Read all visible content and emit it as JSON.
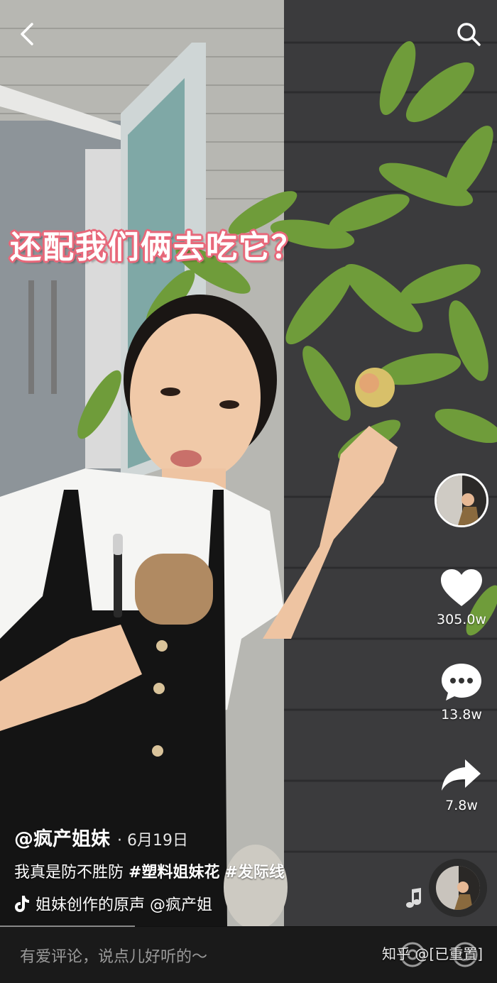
{
  "caption": "还配我们俩去吃它？",
  "stats": {
    "likes": "305.0w",
    "comments": "13.8w",
    "shares": "7.8w"
  },
  "post": {
    "author": "@疯产姐妹",
    "date": "· 6月19日",
    "desc_text": "我真是防不胜防",
    "tags": [
      "#塑料姐妹花",
      "#发际线"
    ],
    "music": "姐妹创作的原声 @疯产姐"
  },
  "comment_placeholder": "有爱评论，说点儿好听的～",
  "watermark": "知乎 @[已重置]",
  "colors": {
    "caption_outline": "#e8687a",
    "bottom_bar": "#1a1a1a"
  },
  "icons": [
    "back-icon",
    "search-icon",
    "heart-icon",
    "comment-icon",
    "share-icon",
    "music-note-icon",
    "tiktok-logo-icon",
    "at-icon",
    "emoji-icon"
  ]
}
